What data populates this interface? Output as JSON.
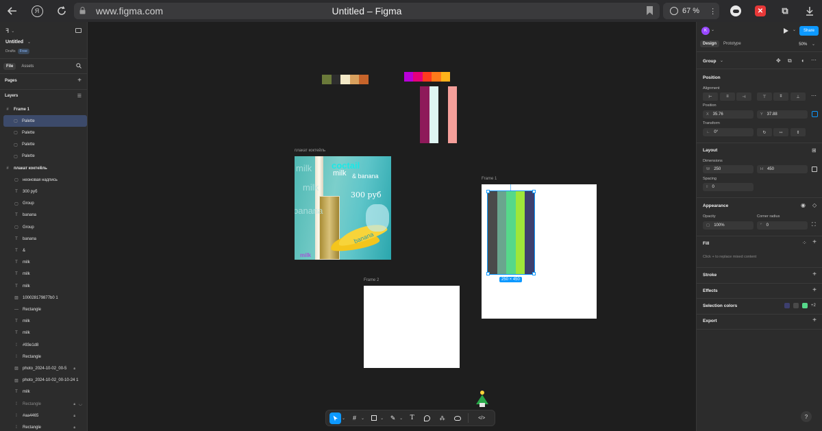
{
  "browser": {
    "url": "www.figma.com",
    "title": "Untitled – Figma",
    "zoom": "67 %",
    "brand_letter": "Я"
  },
  "left_panel": {
    "file_name": "Untitled",
    "location": "Drafts",
    "plan": "Free",
    "tab_file": "File",
    "tab_assets": "Assets",
    "pages_label": "Pages",
    "layers_label": "Layers",
    "layers": [
      {
        "name": "Frame 1",
        "icon": "frame"
      },
      {
        "name": "Palette",
        "icon": "group",
        "selected": true
      },
      {
        "name": "Palette",
        "icon": "group"
      },
      {
        "name": "Palette",
        "icon": "group"
      },
      {
        "name": "Palette",
        "icon": "group"
      },
      {
        "name": "плакат коктейль",
        "icon": "frame"
      },
      {
        "name": "неоновая надпись",
        "icon": "group"
      },
      {
        "name": "300 руб",
        "icon": "text"
      },
      {
        "name": "Group",
        "icon": "group"
      },
      {
        "name": "banana",
        "icon": "text"
      },
      {
        "name": "Group",
        "icon": "group"
      },
      {
        "name": "banana",
        "icon": "text"
      },
      {
        "name": "&",
        "icon": "text"
      },
      {
        "name": "milk",
        "icon": "text"
      },
      {
        "name": "milk",
        "icon": "text"
      },
      {
        "name": "milk",
        "icon": "text"
      },
      {
        "name": "100028179877b0 1",
        "icon": "image"
      },
      {
        "name": "Rectangle",
        "icon": "line"
      },
      {
        "name": "milk",
        "icon": "text"
      },
      {
        "name": "milk",
        "icon": "text"
      },
      {
        "name": "#93e1d8",
        "icon": "rect"
      },
      {
        "name": "Rectangle",
        "icon": "rect"
      },
      {
        "name": "photo_2024-10-02_00-5",
        "icon": "image",
        "locked": true
      },
      {
        "name": "photo_2024-10-02_00-10-24 1",
        "icon": "image"
      },
      {
        "name": "milk",
        "icon": "text"
      },
      {
        "name": "Rectangle",
        "icon": "rect",
        "locked": true,
        "hidden": true
      },
      {
        "name": "#aa4465",
        "icon": "rect",
        "locked": true
      },
      {
        "name": "Rectangle",
        "icon": "rect",
        "locked": true
      }
    ]
  },
  "canvas": {
    "poster_label": "плакат коктейль",
    "frame1_label": "Frame 1",
    "frame2_label": "Frame 2",
    "poster_text": {
      "coctail": "coctail",
      "milk": "milk",
      "and_banana": "& banana",
      "price": "300 руб",
      "milk_bg1": "milk",
      "milk_bg2": "milk",
      "banana_bg": "banana",
      "banana_label": "banana",
      "milk_bottom": "milk"
    },
    "selection_size": "250 × 450",
    "palette_row1": [
      "#6b7a3a",
      "#2d2d2d",
      "#f3e9c7",
      "#d9a15e",
      "#c7642a"
    ],
    "palette_row2": [
      "#b800d8",
      "#e6007a",
      "#ff3b1f",
      "#ff7a1a",
      "#ffb21a"
    ],
    "palette_vertical": [
      "#8e1a5a",
      "#dff6f3",
      "#1e1e1e",
      "#f59f9a"
    ],
    "palette_selected": [
      "#4a4a4a",
      "#6aa58e",
      "#56d88a",
      "#9fe63a",
      "#3d3f6e"
    ]
  },
  "right_panel": {
    "avatar": "K",
    "share": "Share",
    "tab_design": "Design",
    "tab_prototype": "Prototype",
    "zoom": "50%",
    "selection_type": "Group",
    "position_title": "Position",
    "alignment_label": "Alignment",
    "position_label": "Position",
    "x_label": "X",
    "x_value": "35.76",
    "y_label": "Y",
    "y_value": "37.88",
    "transform_label": "Transform",
    "rotation": "0°",
    "layout_title": "Layout",
    "dimensions_label": "Dimensions",
    "w_label": "W",
    "w_value": "250",
    "h_label": "H",
    "h_value": "450",
    "spacing_label": "Spacing",
    "spacing_value": "0",
    "appearance_title": "Appearance",
    "opacity_label": "Opacity",
    "opacity_value": "100%",
    "radius_label": "Corner radius",
    "radius_value": "0",
    "fill_title": "Fill",
    "fill_hint": "Click + to replace mixed content",
    "stroke_title": "Stroke",
    "effects_title": "Effects",
    "selection_colors_title": "Selection colors",
    "selection_colors": [
      "#3d3f6e",
      "#4a4a4a",
      "#56d88a"
    ],
    "selection_colors_more": "+2",
    "export_title": "Export"
  },
  "help": "?"
}
